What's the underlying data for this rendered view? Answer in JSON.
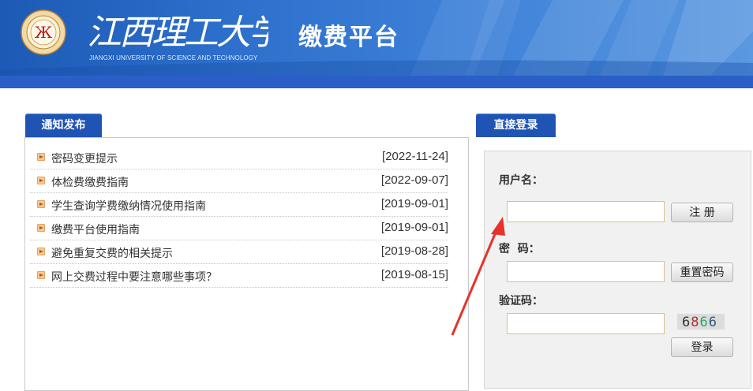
{
  "header": {
    "school_name_cn": "江西理工大学",
    "school_name_en": "JIANGXI UNIVERSITY OF SCIENCE AND TECHNOLOGY",
    "platform_title": "缴费平台",
    "logo_glyph": "Ж"
  },
  "notice": {
    "tab_label": "通知发布",
    "items": [
      {
        "title": "密码变更提示",
        "date": "[2022-11-24]"
      },
      {
        "title": "体检费缴费指南",
        "date": "[2022-09-07]"
      },
      {
        "title": "学生查询学费缴纳情况使用指南",
        "date": "[2019-09-01]"
      },
      {
        "title": "缴费平台使用指南",
        "date": "[2019-09-01]"
      },
      {
        "title": "避免重复交费的相关提示",
        "date": "[2019-08-28]"
      },
      {
        "title": "网上交费过程中要注意哪些事项？",
        "date": "[2019-08-15]"
      }
    ]
  },
  "login": {
    "tab_label": "直接登录",
    "username_label": "用户名：",
    "password_label": "密  码：",
    "captcha_label": "验证码：",
    "username_value": "",
    "password_value": "",
    "captcha_value": "",
    "register_label": "注 册",
    "reset_label": "重置密码",
    "login_label": "登录",
    "captcha_text": "6866"
  },
  "colors": {
    "header_blue": "#2d6fcc",
    "bar_blue": "#2a5fc8",
    "tab_blue": "#2054b4",
    "annotation_red": "#e8322a"
  }
}
